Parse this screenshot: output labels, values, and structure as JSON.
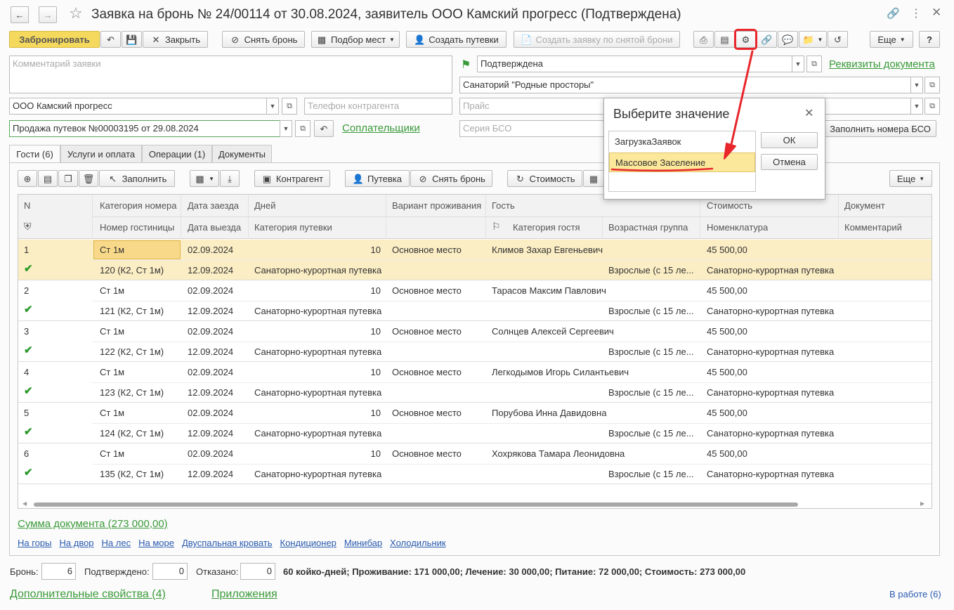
{
  "window": {
    "title": "Заявка на бронь № 24/00114 от 30.08.2024, заявитель ООО Камский прогресс (Подтверждена)"
  },
  "toolbar": {
    "reserve": "Забронировать",
    "close": "Закрыть",
    "unbook": "Снять бронь",
    "pick_places": "Подбор мест",
    "create_vouchers": "Создать путевки",
    "create_from_unbooked": "Создать заявку по снятой брони",
    "more": "Еще",
    "help": "?"
  },
  "form": {
    "comment_placeholder": "Комментарий заявки",
    "counterparty": "ООО Камский прогресс",
    "phone_placeholder": "Телефон контрагента",
    "sale": "Продажа путевок №00003195 от 29.08.2024",
    "copayers_link": "Соплательщики",
    "status": "Подтверждена",
    "doc_requisites_link": "Реквизиты документа",
    "sanatorium": "Санаторий \"Родные просторы\"",
    "price_placeholder": "Прайс",
    "bso_series_placeholder": "Серия БСО",
    "fill_bso_button": "Заполнить номера БСО"
  },
  "tabs": [
    {
      "label": "Гости (6)"
    },
    {
      "label": "Услуги и оплата"
    },
    {
      "label": "Операции (1)"
    },
    {
      "label": "Документы"
    }
  ],
  "grid_toolbar": {
    "fill": "Заполнить",
    "counterparty": "Контрагент",
    "voucher": "Путевка",
    "unbook": "Снять бронь",
    "cost": "Стоимость",
    "more": "Еще"
  },
  "grid": {
    "headers_top": [
      "N",
      "Категория номера",
      "Дата заезда",
      "Дней",
      "Вариант проживания",
      "Гость",
      "Стоимость",
      "Документ"
    ],
    "headers_bottom": [
      "Номер гостиницы",
      "Дата выезда",
      "Категория путевки",
      "Категория гостя",
      "Возрастная группа",
      "Номенклатура",
      "Комментарий"
    ],
    "rows": [
      {
        "n": "1",
        "room_cat": "Ст 1м",
        "arrival": "02.09.2024",
        "days": "10",
        "variant": "Основное место",
        "guest": "Климов Захар Евгеньевич",
        "cost": "45 500,00",
        "room": "120 (К2, Ст 1м)",
        "departure": "12.09.2024",
        "voucher_cat": "Санаторно-курортная путевка",
        "age": "Взрослые (с 15 ле...",
        "nomenclature": "Санаторно-курортная путевка"
      },
      {
        "n": "2",
        "room_cat": "Ст 1м",
        "arrival": "02.09.2024",
        "days": "10",
        "variant": "Основное место",
        "guest": "Тарасов Максим Павлович",
        "cost": "45 500,00",
        "room": "121 (К2, Ст 1м)",
        "departure": "12.09.2024",
        "voucher_cat": "Санаторно-курортная путевка",
        "age": "Взрослые (с 15 ле...",
        "nomenclature": "Санаторно-курортная путевка"
      },
      {
        "n": "3",
        "room_cat": "Ст 1м",
        "arrival": "02.09.2024",
        "days": "10",
        "variant": "Основное место",
        "guest": "Солнцев Алексей Сергеевич",
        "cost": "45 500,00",
        "room": "122 (К2, Ст 1м)",
        "departure": "12.09.2024",
        "voucher_cat": "Санаторно-курортная путевка",
        "age": "Взрослые (с 15 ле...",
        "nomenclature": "Санаторно-курортная путевка"
      },
      {
        "n": "4",
        "room_cat": "Ст 1м",
        "arrival": "02.09.2024",
        "days": "10",
        "variant": "Основное место",
        "guest": "Легкодымов Игорь Силантьевич",
        "cost": "45 500,00",
        "room": "123 (К2, Ст 1м)",
        "departure": "12.09.2024",
        "voucher_cat": "Санаторно-курортная путевка",
        "age": "Взрослые (с 15 ле...",
        "nomenclature": "Санаторно-курортная путевка"
      },
      {
        "n": "5",
        "room_cat": "Ст 1м",
        "arrival": "02.09.2024",
        "days": "10",
        "variant": "Основное место",
        "guest": "Порубова Инна Давидовна",
        "cost": "45 500,00",
        "room": "124 (К2, Ст 1м)",
        "departure": "12.09.2024",
        "voucher_cat": "Санаторно-курортная путевка",
        "age": "Взрослые (с 15 ле...",
        "nomenclature": "Санаторно-курортная путевка"
      },
      {
        "n": "6",
        "room_cat": "Ст 1м",
        "arrival": "02.09.2024",
        "days": "10",
        "variant": "Основное место",
        "guest": "Хохрякова Тамара Леонидовна",
        "cost": "45 500,00",
        "room": "135 (К2, Ст 1м)",
        "departure": "12.09.2024",
        "voucher_cat": "Санаторно-курортная путевка",
        "age": "Взрослые (с 15 ле...",
        "nomenclature": "Санаторно-курортная путевка"
      }
    ]
  },
  "summary": {
    "doc_sum_link": "Сумма документа (273 000,00)",
    "tags": [
      "На горы",
      "На двор",
      "На лес",
      "На море",
      "Двуспальная кровать",
      "Кондиционер",
      "Минибар",
      "Холодильник"
    ]
  },
  "footer": {
    "booked_label": "Бронь:",
    "booked_value": "6",
    "confirmed_label": "Подтверждено:",
    "confirmed_value": "0",
    "refused_label": "Отказано:",
    "refused_value": "0",
    "totals": "60 койко-дней; Проживание: 171 000,00; Лечение: 30 000,00; Питание: 72 000,00; Стоимость: 273 000,00",
    "extra_props_link": "Дополнительные свойства (4)",
    "attachments_link": "Приложения",
    "in_work_link": "В работе (6)"
  },
  "dialog": {
    "title": "Выберите значение",
    "options": [
      "ЗагрузкаЗаявок",
      "Массовое Заселение"
    ],
    "selected_index": 1,
    "ok": "ОК",
    "cancel": "Отмена"
  },
  "colors": {
    "accent_yellow": "#f5d95d",
    "selected_row": "#fbedc4",
    "link_green": "#3a9a3a",
    "annotation_red": "#e8262b"
  }
}
